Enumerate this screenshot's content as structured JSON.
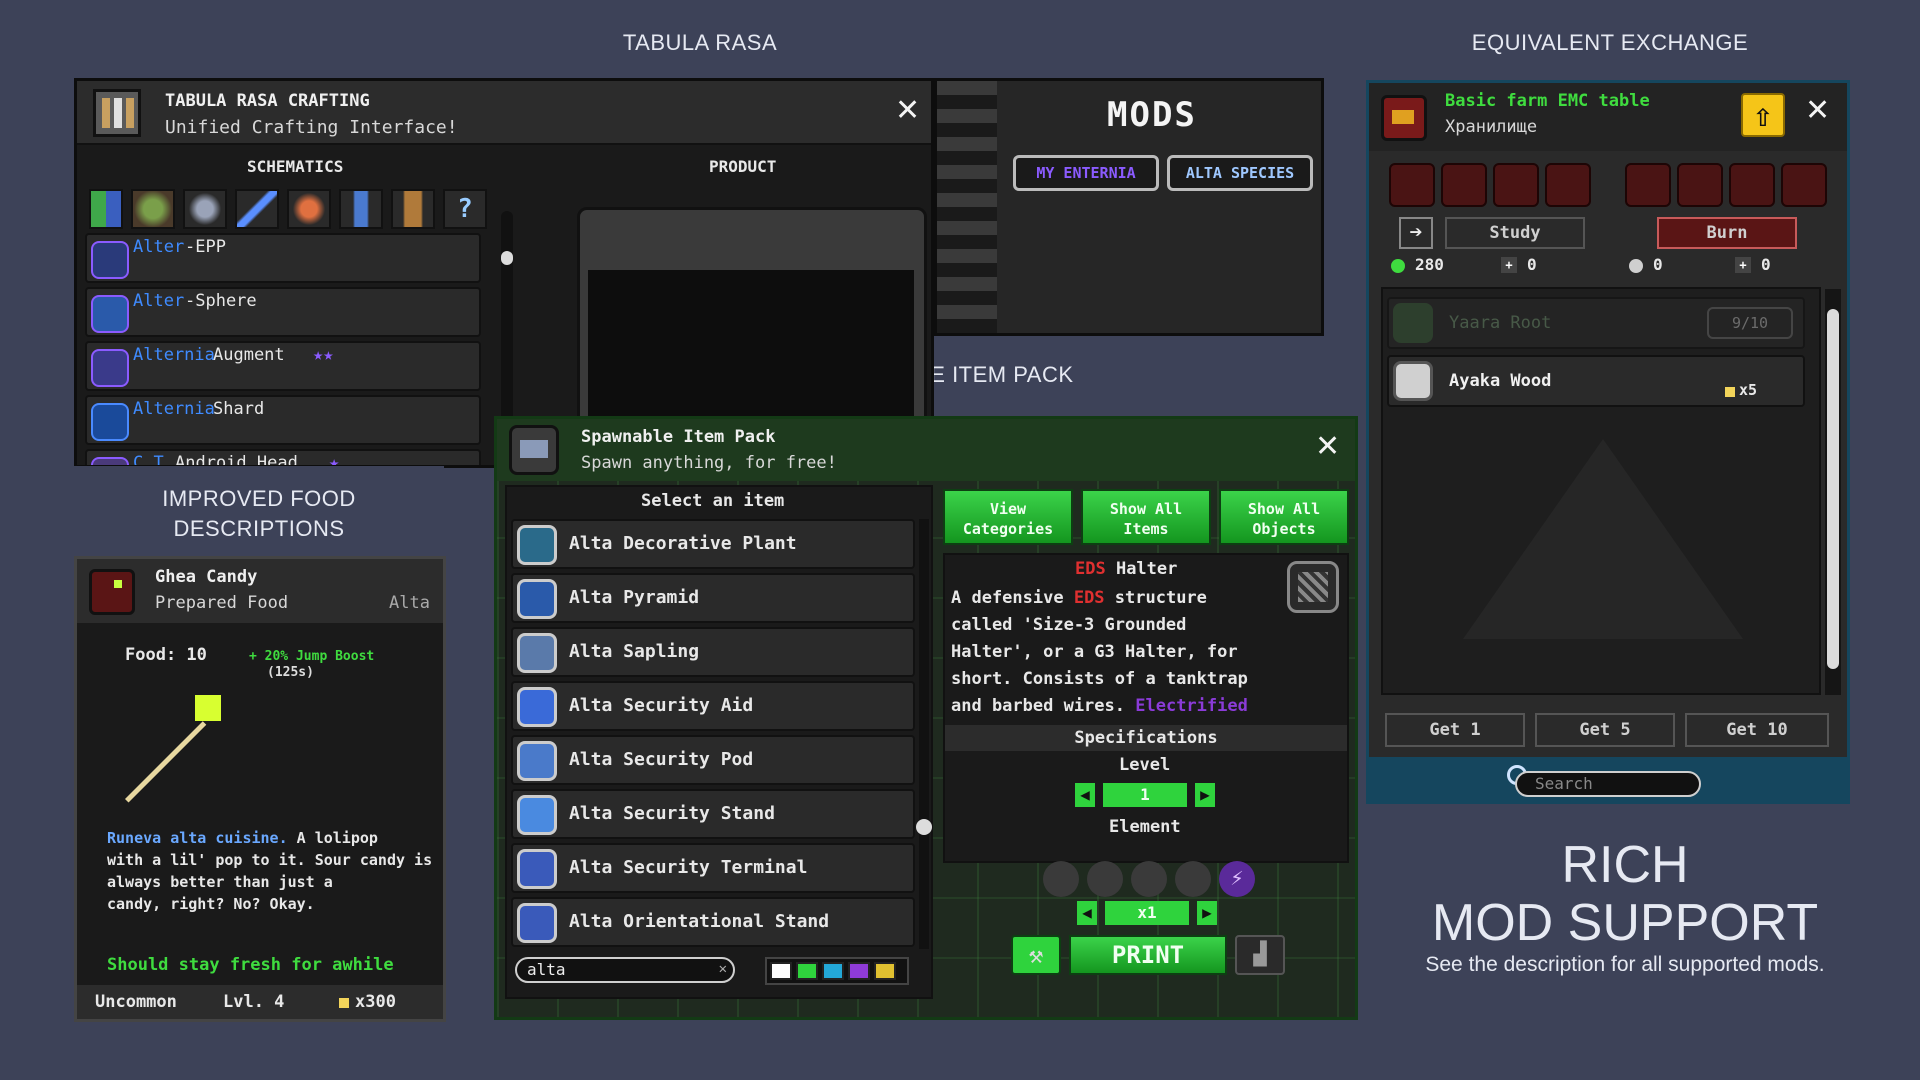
{
  "captions": {
    "tabula": "TABULA RASA",
    "equivalent": "EQUIVALENT EXCHANGE",
    "spawnable": "SPAWNABLE ITEM PACK",
    "food_line1": "IMPROVED FOOD",
    "food_line2": "DESCRIPTIONS",
    "rich_line1": "RICH",
    "rich_line2": "MOD SUPPORT",
    "rich_sub": "See the description for all supported mods."
  },
  "tabula": {
    "title": "TABULA RASA CRAFTING",
    "subtitle": "Unified Crafting Interface!",
    "close": "✕",
    "col_schematics": "SCHEMATICS",
    "col_product": "PRODUCT",
    "category_icons": [
      "grid-icon",
      "plant-icon",
      "armor-icon",
      "sword-icon",
      "food-icon",
      "tool-icon",
      "furniture-icon",
      "help-icon"
    ],
    "items": [
      {
        "prefix": "Alter",
        "name": "-EPP",
        "stars": ""
      },
      {
        "prefix": "Alter",
        "name": "-Sphere",
        "stars": ""
      },
      {
        "prefix": "Alternia",
        "name": " Augment",
        "stars": "★★"
      },
      {
        "prefix": "Alternia",
        "name": " Shard",
        "stars": ""
      },
      {
        "prefix": "C.T.",
        "name": " Android Head",
        "stars": "★"
      }
    ],
    "mods_title": "MODS",
    "mods_tabs": [
      "MY ENTERNIA",
      "ALTA SPECIES"
    ]
  },
  "emc": {
    "title": "Basic farm EMC table",
    "subtitle": "Хранилище",
    "close": "✕",
    "study": "Study",
    "burn": "Burn",
    "stat_emc": "280",
    "stat_a": "0",
    "stat_b": "0",
    "stat_c": "0",
    "items": [
      {
        "name": "Yaara Root",
        "count": "9/10",
        "muted": true
      },
      {
        "name": "Ayaka Wood",
        "count": "x5",
        "muted": false
      }
    ],
    "get_buttons": [
      "Get 1",
      "Get 5",
      "Get 10"
    ],
    "search_placeholder": "Search"
  },
  "spawn": {
    "title": "Spawnable Item Pack",
    "subtitle": "Spawn anything, for free!",
    "close": "✕",
    "list_header": "Select an item",
    "items": [
      "Alta Decorative Plant",
      "Alta Pyramid",
      "Alta Sapling",
      "Alta Security Aid",
      "Alta Security Pod",
      "Alta Security Stand",
      "Alta Security Terminal",
      "Alta Orientational Stand"
    ],
    "buttons": {
      "view_categories": [
        "View",
        "Categories"
      ],
      "show_items": [
        "Show All",
        "Items"
      ],
      "show_objects": [
        "Show All",
        "Objects"
      ]
    },
    "detail_title_prefix": "EDS",
    "detail_title": " Halter",
    "desc_1": "A defensive ",
    "desc_eds": "EDS",
    "desc_2": " structure",
    "desc_3": "called 'Size-3 Grounded",
    "desc_4": "Halter', or a G3 Halter, for",
    "desc_5": "short. Consists of a tanktrap",
    "desc_6": "and barbed wires.",
    "desc_electrified": "Electrified",
    "specs_label": "Specifications",
    "level_label": "Level",
    "level_value": "1",
    "element_label": "Element",
    "qty_value": "x1",
    "print_label": "PRINT",
    "search_value": "alta",
    "search_clear": "✕",
    "colors": [
      "#ffffff",
      "#2fd33d",
      "#23a8d8",
      "#8f3bd8",
      "#e0c030"
    ]
  },
  "food": {
    "name": "Ghea Candy",
    "category": "Prepared Food",
    "species": "Alta",
    "food_label": "Food: 10",
    "buff": "+ 20% Jump Boost",
    "buff_duration": "(125s)",
    "desc_highlight": "Runeva alta cuisine.",
    "desc_lines": [
      " A lolipop",
      "with a lil' pop to it. Sour candy is",
      "always better than just a",
      "candy, right? No? Okay."
    ],
    "fresh": "Should stay fresh for awhile",
    "rarity": "Uncommon",
    "level": "Lvl. 4",
    "price": "x300"
  }
}
